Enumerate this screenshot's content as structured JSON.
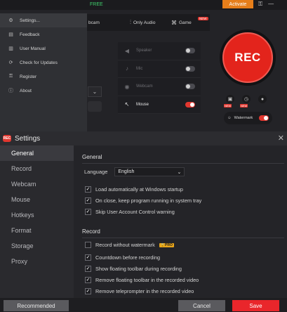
{
  "topbar": {
    "free_label": "FREE",
    "activate_label": "Activate",
    "key_icon": "key-icon",
    "minimize_icon": "minimize-icon"
  },
  "modes": [
    {
      "label": "Webcam",
      "visible_label": "bcam",
      "icon": "webcam-icon"
    },
    {
      "label": "Only Audio",
      "icon": "audio-wave-icon"
    },
    {
      "label": "Game",
      "icon": "gamepad-icon"
    }
  ],
  "new_tag": "NEW",
  "sources": [
    {
      "label": "Speaker",
      "icon": "speaker-icon",
      "enabled": false
    },
    {
      "label": "Mic",
      "icon": "mic-icon",
      "enabled": false
    },
    {
      "label": "Webcam",
      "icon": "webcam-icon",
      "enabled": false
    },
    {
      "label": "Mouse",
      "icon": "mouse-icon",
      "enabled": true
    }
  ],
  "rec_button": {
    "label": "REC",
    "color": "#e3241c"
  },
  "small_tools": [
    {
      "icon": "screenshot-icon",
      "badge": "NEW"
    },
    {
      "icon": "timer-icon",
      "badge": "NEW"
    },
    {
      "icon": "record-drop-icon",
      "badge": ""
    }
  ],
  "watermark": {
    "label": "Watermark",
    "icon": "user-icon",
    "enabled": true
  },
  "dropdown_menu": [
    {
      "label": "Settings...",
      "icon": "gear-icon",
      "highlighted": true
    },
    {
      "label": "Feedback",
      "icon": "feedback-icon",
      "highlighted": false
    },
    {
      "label": "User Manual",
      "icon": "manual-icon",
      "highlighted": false
    },
    {
      "label": "Check for Updates",
      "icon": "update-icon",
      "highlighted": false
    },
    {
      "label": "Register",
      "icon": "key-icon",
      "highlighted": false
    },
    {
      "label": "About",
      "icon": "info-icon",
      "highlighted": false
    }
  ],
  "settings": {
    "title": "Settings",
    "logo_text": "REC",
    "nav": [
      "General",
      "Record",
      "Webcam",
      "Mouse",
      "Hotkeys",
      "Format",
      "Storage",
      "Proxy"
    ],
    "active_nav": "General",
    "general": {
      "heading": "General",
      "language_label": "Language",
      "language_value": "English",
      "options": [
        {
          "label": "Load automatically at Windows startup",
          "checked": true
        },
        {
          "label": "On close, keep program running in system tray",
          "checked": true
        },
        {
          "label": "Skip User Account Control warning",
          "checked": true
        }
      ]
    },
    "record": {
      "heading": "Record",
      "options": [
        {
          "label": "Record without watermark",
          "checked": false,
          "badge": "PRO"
        },
        {
          "label": "Countdown before recording",
          "checked": true,
          "badge": ""
        },
        {
          "label": "Show floating toolbar during recording",
          "checked": true,
          "badge": ""
        },
        {
          "label": "Remove floating toolbar in the recorded video",
          "checked": true,
          "badge": ""
        },
        {
          "label": "Remove teleprompter in the recorded video",
          "checked": true,
          "badge": ""
        }
      ]
    },
    "footer": {
      "recommended_label": "Recommended",
      "cancel_label": "Cancel",
      "save_label": "Save"
    }
  },
  "colors": {
    "accent": "#e2372f",
    "activate": "#e67e1a",
    "pro": "#e8a51a"
  }
}
